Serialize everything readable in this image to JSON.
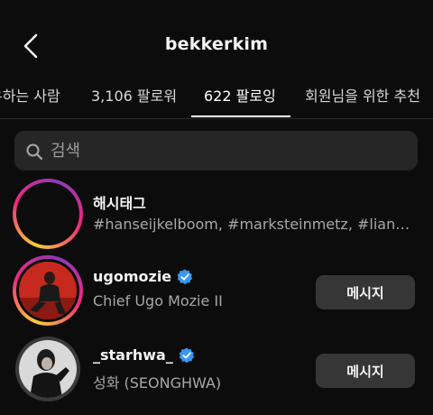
{
  "header": {
    "title": "bekkerkim"
  },
  "tabs": [
    {
      "label": "우하는 사람"
    },
    {
      "label": "3,106 팔로워"
    },
    {
      "label": "622 팔로잉",
      "active": true
    },
    {
      "label": "회원님을 위한 추천"
    }
  ],
  "search": {
    "placeholder": "검색",
    "value": ""
  },
  "following": [
    {
      "username": "해시태그",
      "subtitle": "#hanseijkelboom, #marksteinmetz, #lianne...",
      "verified": false,
      "avatar": "hashtag-icon",
      "ring": "story-gradient"
    },
    {
      "username": "ugomozie",
      "subtitle": "Chief Ugo Mozie II",
      "verified": true,
      "avatar": "user-photo",
      "ring": "story-gradient",
      "button": "메시지"
    },
    {
      "username": "_starhwa_",
      "subtitle": "성화 (SEONGHWA)",
      "verified": true,
      "avatar": "user-photo",
      "ring": "gray",
      "button": "메시지"
    }
  ],
  "colors": {
    "background": "#0c0c0c",
    "search_bg": "#262626",
    "button_bg": "#363636",
    "verified": "#3897f0"
  }
}
